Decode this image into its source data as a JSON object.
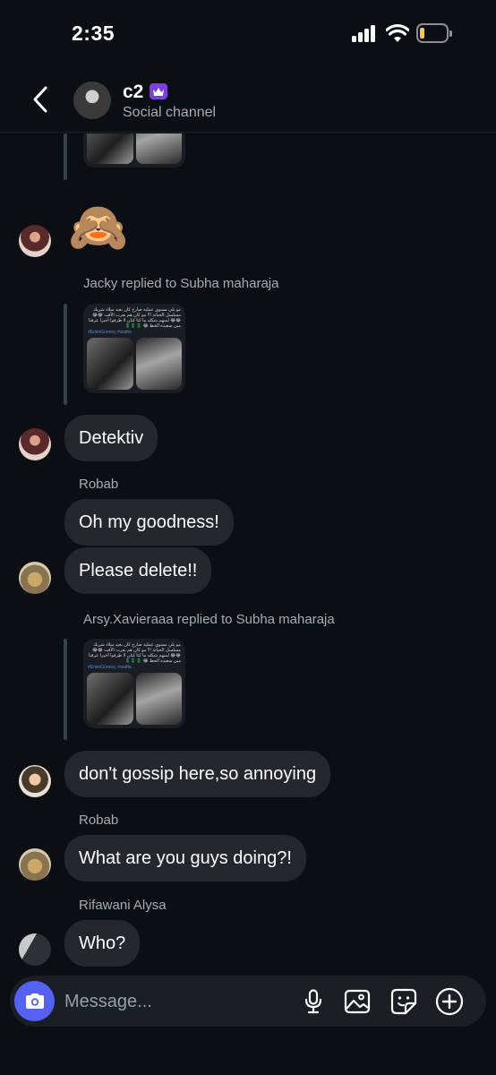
{
  "status_bar": {
    "time": "2:35"
  },
  "header": {
    "title": "c2",
    "subtitle": "Social channel"
  },
  "messages": {
    "emoji": "🙈",
    "reply1": {
      "label": "Jacky replied to Subha maharaja"
    },
    "detektiv": "Detektiv",
    "robab1": {
      "sender": "Robab",
      "line1": "Oh my goodness!",
      "line2": "Please delete!!"
    },
    "reply2": {
      "label": "Arsy.Xavieraaa replied to Subha maharaja"
    },
    "gossip": "don't gossip here,so annoying",
    "robab2": {
      "sender": "Robab",
      "text": "What are you guys doing?!"
    },
    "rifawani": {
      "sender": "Rifawani Alysa",
      "text": "Who?"
    }
  },
  "media_card": {
    "caption": "مو بلي مسوي عملية صارخ كان بعيد ميلاد شريك مسلسل الخيانة !!! مو كان هم يعرت الأقت 😂😂😂😂 لمتهم شكله ما كنا كنان لا طرفوا أخيرا عرفنا مين سعيدة الحظ 😂 💲💲💲",
    "tags": "#EminGünenç #arafta"
  },
  "composer": {
    "placeholder": "Message..."
  },
  "icons": {
    "back": "chevron-left-icon",
    "crown": "crown-icon",
    "camera": "camera-icon",
    "mic": "microphone-icon",
    "gallery": "image-icon",
    "sticker": "sticker-icon",
    "add": "plus-circle-icon"
  },
  "colors": {
    "background": "#0b0e13",
    "bubble": "#24272d",
    "accent": "#5561f2",
    "badge": "#7b3fe4",
    "battery": "#f7c948"
  }
}
